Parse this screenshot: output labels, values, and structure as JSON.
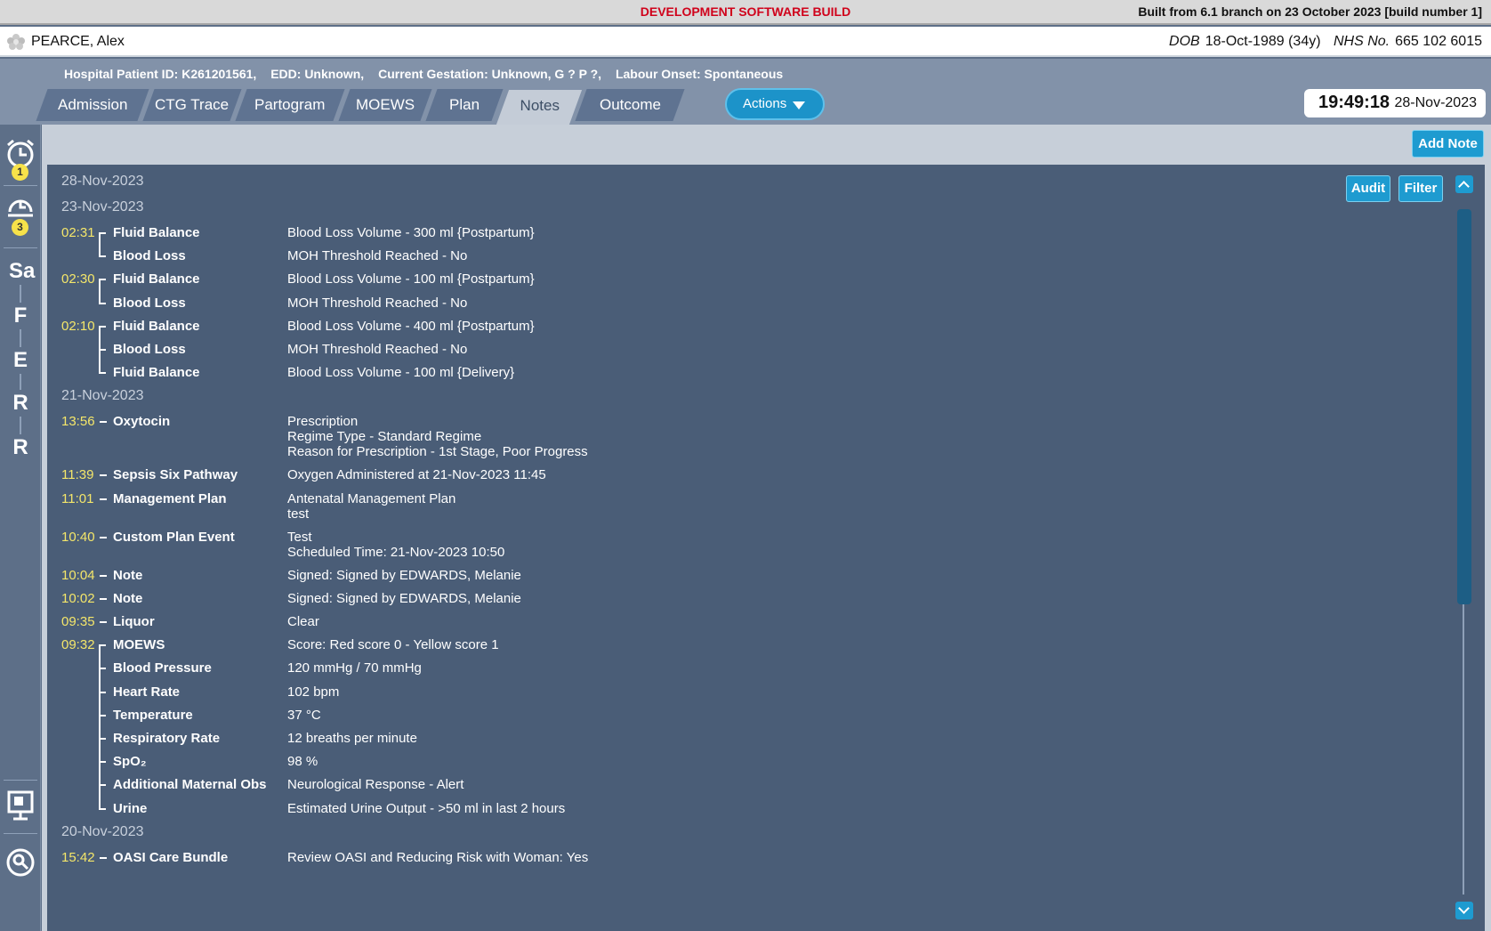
{
  "dev_banner": {
    "title": "DEVELOPMENT SOFTWARE BUILD",
    "build_info": "Built from 6.1 branch on 23 October 2023 [build number 1]"
  },
  "patient": {
    "name": "PEARCE, Alex",
    "dob_label": "DOB",
    "dob": "18-Oct-1989 (34y)",
    "nhs_label": "NHS No.",
    "nhs": "665 102 6015"
  },
  "info_line": {
    "hospital_id": "Hospital Patient ID: K261201561,",
    "edd": "EDD: Unknown,",
    "gestation": "Current Gestation: Unknown, G ? P ?,",
    "labour": "Labour Onset: Spontaneous"
  },
  "tabs": [
    {
      "label": "Admission"
    },
    {
      "label": "CTG Trace"
    },
    {
      "label": "Partogram"
    },
    {
      "label": "MOEWS"
    },
    {
      "label": "Plan"
    },
    {
      "label": "Notes"
    },
    {
      "label": "Outcome"
    }
  ],
  "active_tab": "Notes",
  "actions_label": "Actions",
  "clock": {
    "time": "19:49:18",
    "date": "28-Nov-2023"
  },
  "rail": {
    "alarm_badge": "1",
    "snooze_badge": "3",
    "letters": [
      "Sa",
      "F",
      "E",
      "R",
      "R"
    ]
  },
  "toolbar": {
    "add_note": "Add Note",
    "audit": "Audit",
    "filter": "Filter"
  },
  "notes": [
    {
      "date": "28-Nov-2023",
      "entries": []
    },
    {
      "date": "23-Nov-2023",
      "entries": [
        {
          "time": "02:31",
          "items": [
            {
              "label": "Fluid Balance",
              "values": [
                "Blood Loss Volume - 300 ml {Postpartum}"
              ]
            },
            {
              "label": "Blood Loss",
              "values": [
                "MOH Threshold Reached - No"
              ]
            }
          ]
        },
        {
          "time": "02:30",
          "items": [
            {
              "label": "Fluid Balance",
              "values": [
                "Blood Loss Volume - 100 ml {Postpartum}"
              ]
            },
            {
              "label": "Blood Loss",
              "values": [
                "MOH Threshold Reached - No"
              ]
            }
          ]
        },
        {
          "time": "02:10",
          "items": [
            {
              "label": "Fluid Balance",
              "values": [
                "Blood Loss Volume - 400 ml {Postpartum}"
              ]
            },
            {
              "label": "Blood Loss",
              "values": [
                "MOH Threshold Reached - No"
              ]
            },
            {
              "label": "Fluid Balance",
              "values": [
                "Blood Loss Volume - 100 ml {Delivery}"
              ]
            }
          ]
        }
      ]
    },
    {
      "date": "21-Nov-2023",
      "entries": [
        {
          "time": "13:56",
          "items": [
            {
              "label": "Oxytocin",
              "values": [
                "Prescription",
                "Regime Type - Standard Regime",
                "Reason for Prescription - 1st Stage, Poor Progress"
              ]
            }
          ]
        },
        {
          "time": "11:39",
          "items": [
            {
              "label": "Sepsis Six Pathway",
              "values": [
                "Oxygen Administered at 21-Nov-2023 11:45"
              ]
            }
          ]
        },
        {
          "time": "11:01",
          "items": [
            {
              "label": "Management Plan",
              "values": [
                "Antenatal Management Plan",
                "test"
              ]
            }
          ]
        },
        {
          "time": "10:40",
          "items": [
            {
              "label": "Custom Plan Event",
              "values": [
                "Test",
                "Scheduled Time: 21-Nov-2023 10:50"
              ]
            }
          ]
        },
        {
          "time": "10:04",
          "items": [
            {
              "label": "Note",
              "values": [
                "Signed: Signed by EDWARDS, Melanie"
              ]
            }
          ]
        },
        {
          "time": "10:02",
          "items": [
            {
              "label": "Note",
              "values": [
                "Signed: Signed by EDWARDS, Melanie"
              ]
            }
          ]
        },
        {
          "time": "09:35",
          "items": [
            {
              "label": "Liquor",
              "values": [
                "Clear"
              ]
            }
          ]
        },
        {
          "time": "09:32",
          "items": [
            {
              "label": "MOEWS",
              "values": [
                "Score: Red score 0 - Yellow score 1"
              ]
            },
            {
              "label": "Blood Pressure",
              "values": [
                "120 mmHg / 70 mmHg"
              ]
            },
            {
              "label": "Heart Rate",
              "values": [
                "102 bpm"
              ]
            },
            {
              "label": "Temperature",
              "values": [
                "37 °C"
              ]
            },
            {
              "label": "Respiratory Rate",
              "values": [
                "12 breaths per minute"
              ]
            },
            {
              "label": "SpO₂",
              "values": [
                "98 %"
              ]
            },
            {
              "label": "Additional Maternal Obs",
              "values": [
                "Neurological Response - Alert"
              ]
            },
            {
              "label": "Urine",
              "values": [
                "Estimated Urine Output - >50 ml in last 2 hours"
              ]
            }
          ]
        }
      ]
    },
    {
      "date": "20-Nov-2023",
      "entries": [
        {
          "time": "15:42",
          "items": [
            {
              "label": "OASI Care Bundle",
              "values": [
                "Review OASI and Reducing Risk with Woman: Yes"
              ]
            }
          ]
        }
      ]
    }
  ],
  "colors": {
    "time_text": "#f4e66a",
    "accent_button": "#1e9bd0",
    "panel_bg": "#4a5d77",
    "dev_banner_text": "#d0021b"
  }
}
